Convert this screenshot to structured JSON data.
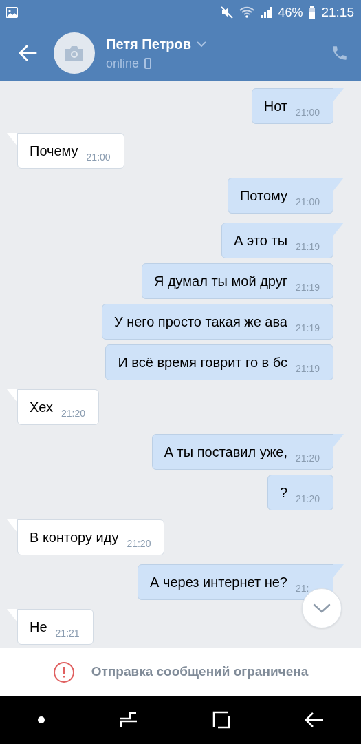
{
  "status_bar": {
    "battery": "46%",
    "time": "21:15"
  },
  "header": {
    "name": "Петя Петров",
    "status": "online"
  },
  "messages": [
    {
      "kind": "out",
      "text": "Нот",
      "time": "21:00",
      "tail": true
    },
    {
      "kind": "in",
      "text": "Почему",
      "time": "21:00",
      "tail": true
    },
    {
      "kind": "out",
      "text": "Потому",
      "time": "21:00",
      "tail": true
    },
    {
      "kind": "out",
      "text": "А это ты",
      "time": "21:19",
      "tail": true
    },
    {
      "kind": "out",
      "text": "Я думал ты мой друг",
      "time": "21:19",
      "tail": false
    },
    {
      "kind": "out",
      "text": "У него просто такая же ава",
      "time": "21:19",
      "tail": false
    },
    {
      "kind": "out",
      "text": "И всё время говрит го в бс",
      "time": "21:19",
      "tail": false
    },
    {
      "kind": "in",
      "text": "Хех",
      "time": "21:20",
      "tail": true
    },
    {
      "kind": "out",
      "text": "А ты поставил уже,",
      "time": "21:20",
      "tail": true
    },
    {
      "kind": "out",
      "text": "?",
      "time": "21:20",
      "tail": false
    },
    {
      "kind": "in",
      "text": "В контору иду",
      "time": "21:20",
      "tail": true
    },
    {
      "kind": "out",
      "text": "А через интернет не?",
      "time": "21:",
      "tail": true
    },
    {
      "kind": "in",
      "text": "Не",
      "time": "21:21",
      "tail": true
    }
  ],
  "notice": {
    "text": "Отправка сообщений ограничена"
  }
}
